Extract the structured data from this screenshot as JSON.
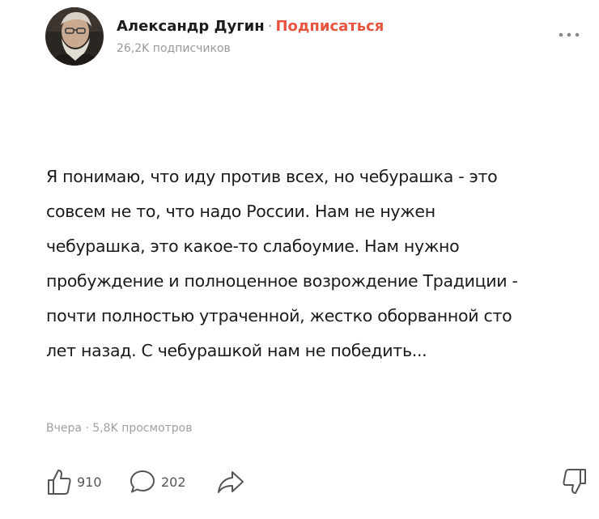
{
  "header": {
    "author_name": "Александр Дугин",
    "separator": "·",
    "subscribe_label": "Подписаться",
    "subscribers": "26,2K подписчиков"
  },
  "post": {
    "lines": [
      "Я понимаю, что иду против всех, но чебурашка - это",
      "совсем не то, что надо России. Нам не нужен",
      "чебурашка, это какое-то слабоумие. Нам нужно",
      "пробуждение и полноценное возрождение Традиции -",
      "почти полностью утраченной, жестко оборванной сто",
      "лет назад. С чебурашкой нам не победить..."
    ],
    "meta": "Вчера · 5,8K просмотров"
  },
  "actions": {
    "likes": "910",
    "comments": "202"
  },
  "icons": {
    "more": "more-dots-icon",
    "like": "thumbs-up-icon",
    "comment": "comment-bubble-icon",
    "share": "share-arrow-icon",
    "dislike": "thumbs-down-icon"
  },
  "colors": {
    "accent": "#e8543f",
    "muted": "#999999",
    "icon": "#555555"
  }
}
